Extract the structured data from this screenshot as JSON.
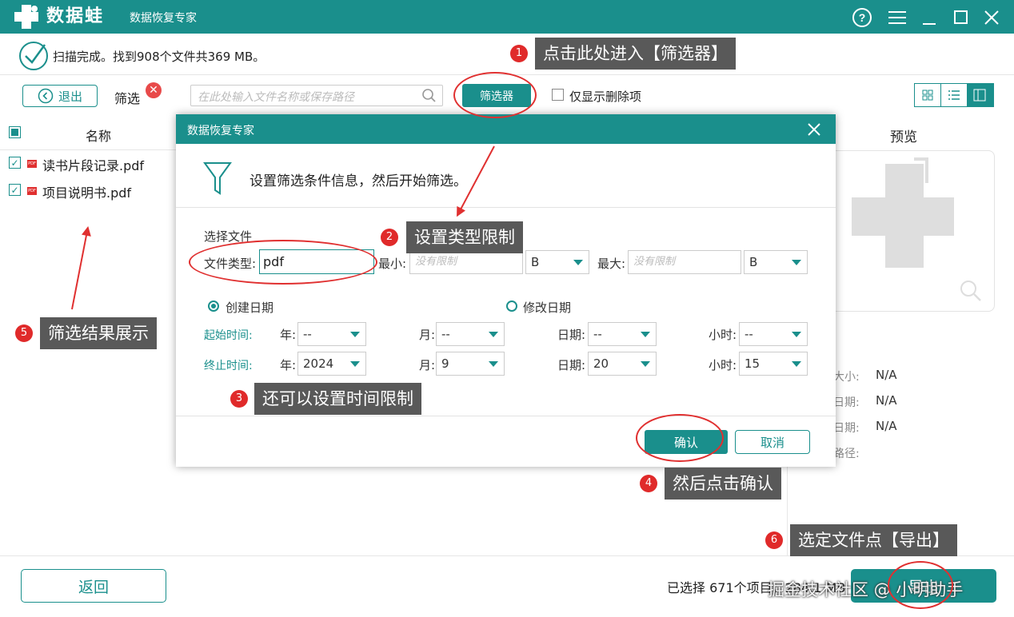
{
  "titlebar": {
    "app_name": "数据蛙",
    "subtitle": "数据恢复专家",
    "icons": [
      "help-icon",
      "menu-icon",
      "minimize-icon",
      "maximize-icon",
      "close-icon"
    ]
  },
  "status": {
    "text": "扫描完成。找到908个文件共369 MB。"
  },
  "toolbar": {
    "exit_label": "退出",
    "filter_label": "筛选",
    "search_placeholder": "在此处输入文件名称或保存路径",
    "filter_button": "筛选器",
    "only_deleted_label": "仅显示删除项"
  },
  "list": {
    "header_name": "名称",
    "items": [
      {
        "name": "读书片段记录.pdf"
      },
      {
        "name": "项目说明书.pdf"
      }
    ]
  },
  "preview": {
    "title": "预览",
    "info": [
      {
        "label": "大小:",
        "value": "N/A"
      },
      {
        "label": "日期:",
        "value": "N/A"
      },
      {
        "label": "日期:",
        "value": "N/A"
      },
      {
        "label": "路径:",
        "value": ""
      }
    ]
  },
  "dialog": {
    "title": "数据恢复专家",
    "heading": "设置筛选条件信息，然后开始筛选。",
    "section_file": "选择文件",
    "file_type_label": "文件类型:",
    "file_type_value": "pdf",
    "min_label": "最小:",
    "min_placeholder": "没有限制",
    "min_unit": "B",
    "max_label": "最大:",
    "max_placeholder": "没有限制",
    "max_unit": "B",
    "radio_created": "创建日期",
    "radio_modified": "修改日期",
    "start_label": "起始时间:",
    "end_label": "终止时间:",
    "year_label": "年:",
    "month_label": "月:",
    "day_label": "日期:",
    "hour_label": "小时:",
    "start": {
      "year": "--",
      "month": "--",
      "day": "--",
      "hour": "--"
    },
    "end": {
      "year": "2024",
      "month": "9",
      "day": "20",
      "hour": "15"
    },
    "confirm": "确认",
    "cancel": "取消"
  },
  "callouts": [
    {
      "num": "1",
      "text": "点击此处进入【筛选器】"
    },
    {
      "num": "2",
      "text": "设置类型限制"
    },
    {
      "num": "3",
      "text": "还可以设置时间限制"
    },
    {
      "num": "4",
      "text": "然后点击确认"
    },
    {
      "num": "5",
      "text": "筛选结果展示"
    },
    {
      "num": "6",
      "text": "选定文件点【导出】"
    }
  ],
  "footer": {
    "back_label": "返回",
    "selected_text": "已选择 671个项目，284.1 MB",
    "export_label": "导出",
    "watermark": "掘金技术社区 @ 小明助手"
  },
  "colors": {
    "accent": "#1a8f8c",
    "annotation": "#e03030",
    "callout_bg": "#595959"
  }
}
